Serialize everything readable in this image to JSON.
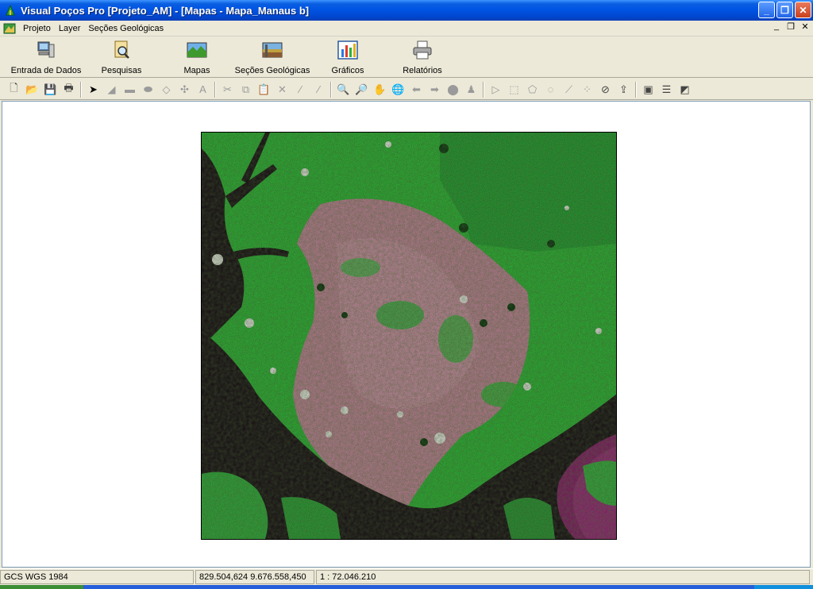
{
  "window": {
    "title": "Visual Poços Pro [Projeto_AM] - [Mapas - Mapa_Manaus b]",
    "buttons": {
      "minimize": "_",
      "maximize": "❐",
      "close": "✕"
    }
  },
  "menubar": {
    "items": [
      "Projeto",
      "Layer",
      "Seções Geológicas"
    ],
    "mdi_buttons": {
      "minimize": "_",
      "restore": "❐",
      "close": "✕"
    }
  },
  "main_toolbar": {
    "buttons": [
      {
        "label": "Entrada de Dados",
        "icon": "computer-icon"
      },
      {
        "label": "Pesquisas",
        "icon": "search-document-icon"
      },
      {
        "label": "Mapas",
        "icon": "map-landscape-icon"
      },
      {
        "label": "Seções Geológicas",
        "icon": "geologic-section-icon"
      },
      {
        "label": "Gráficos",
        "icon": "bar-chart-icon"
      },
      {
        "label": "Relatórios",
        "icon": "printer-icon"
      }
    ]
  },
  "tools": {
    "new": "🗋",
    "open": "📂",
    "save": "💾",
    "print": "🖶",
    "select": "➤",
    "polyline": "◢",
    "rectangle": "▬",
    "ellipse": "⬬",
    "polygon": "◇",
    "point": "✣",
    "text": "A",
    "cut": "✂",
    "copy": "⧉",
    "paste": "📋",
    "delete": "✕",
    "cut_line": "⁄",
    "cut_line2": "⁄",
    "zoom_in": "🔍",
    "zoom_out": "🔎",
    "pan": "✋",
    "globe": "🌐",
    "back": "⬅",
    "forward": "➡",
    "identify": "⬤",
    "measure": "♟",
    "sel_arrow": "▷",
    "sel_rect": "⬚",
    "sel_poly": "⬠",
    "sel_circle": "◌",
    "sel_line": "⟋",
    "sel_points": "⁘",
    "clear": "⊘",
    "export": "⇪",
    "legend": "▣",
    "layers": "☰",
    "notes": "◩"
  },
  "status": {
    "coordinate_system": "GCS WGS 1984",
    "coordinates": "829.504,624  9.676.558,450",
    "scale": "1 : 72.046.210"
  },
  "colors": {
    "titlebar": "#0054e3",
    "chrome": "#ece9d8",
    "vegetation": "#2fbf3a",
    "urban": "#c98aa0",
    "river": "#1a0f18",
    "river_sediment": "#8c1f6e"
  }
}
